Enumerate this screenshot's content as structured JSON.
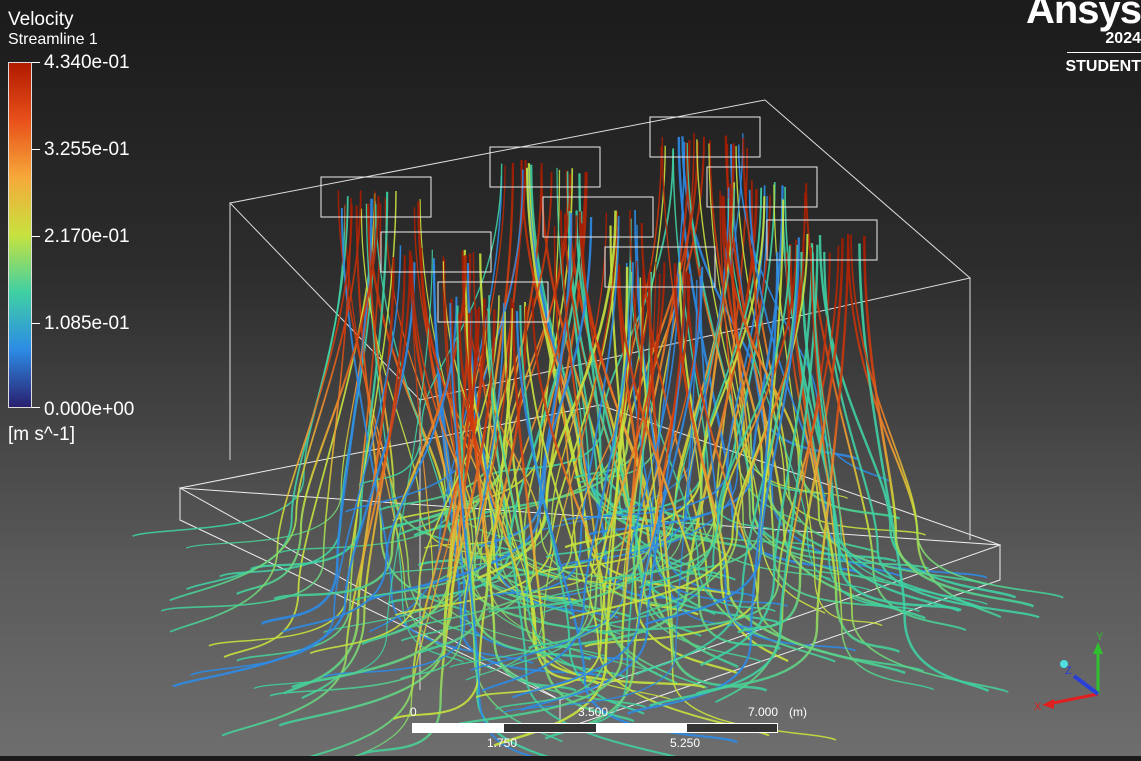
{
  "legend": {
    "title": "Velocity",
    "subtitle": "Streamline 1",
    "ticks": [
      "4.340e-01",
      "3.255e-01",
      "2.170e-01",
      "1.085e-01",
      "0.000e+00"
    ],
    "unit": "[m s^-1]",
    "colormap": [
      "#b01a00",
      "#e8501a",
      "#f6a93a",
      "#c7e23e",
      "#3fd0a4",
      "#2d8be6",
      "#2a1f6e"
    ]
  },
  "branding": {
    "name": "Ansys",
    "year": "2024",
    "edition": "STUDENT"
  },
  "scale_bar": {
    "top_labels": [
      "0",
      "3.500",
      "7.000"
    ],
    "unit": "(m)",
    "bottom_labels": [
      "1.750",
      "5.250"
    ]
  },
  "triad": {
    "x_label": "X",
    "y_label": "Y",
    "z_label": "Z"
  }
}
